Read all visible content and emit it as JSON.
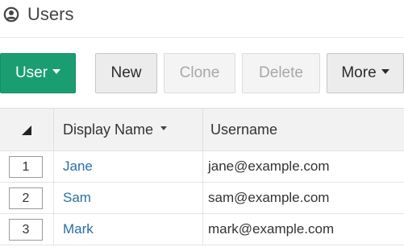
{
  "header": {
    "title": "Users",
    "icon": "user-circle-icon"
  },
  "toolbar": {
    "user_label": "User",
    "new_label": "New",
    "clone_label": "Clone",
    "delete_label": "Delete",
    "more_label": "More"
  },
  "table": {
    "columns": {
      "display_name": "Display Name",
      "username": "Username"
    },
    "rows": [
      {
        "num": "1",
        "display_name": "Jane",
        "username": "jane@example.com"
      },
      {
        "num": "2",
        "display_name": "Sam",
        "username": "sam@example.com"
      },
      {
        "num": "3",
        "display_name": "Mark",
        "username": "mark@example.com"
      }
    ]
  },
  "colors": {
    "primary_button": "#1a9e71",
    "link": "#2a6ea6",
    "header_bg": "#f2f2f2",
    "disabled_text": "#a8a8a8"
  }
}
